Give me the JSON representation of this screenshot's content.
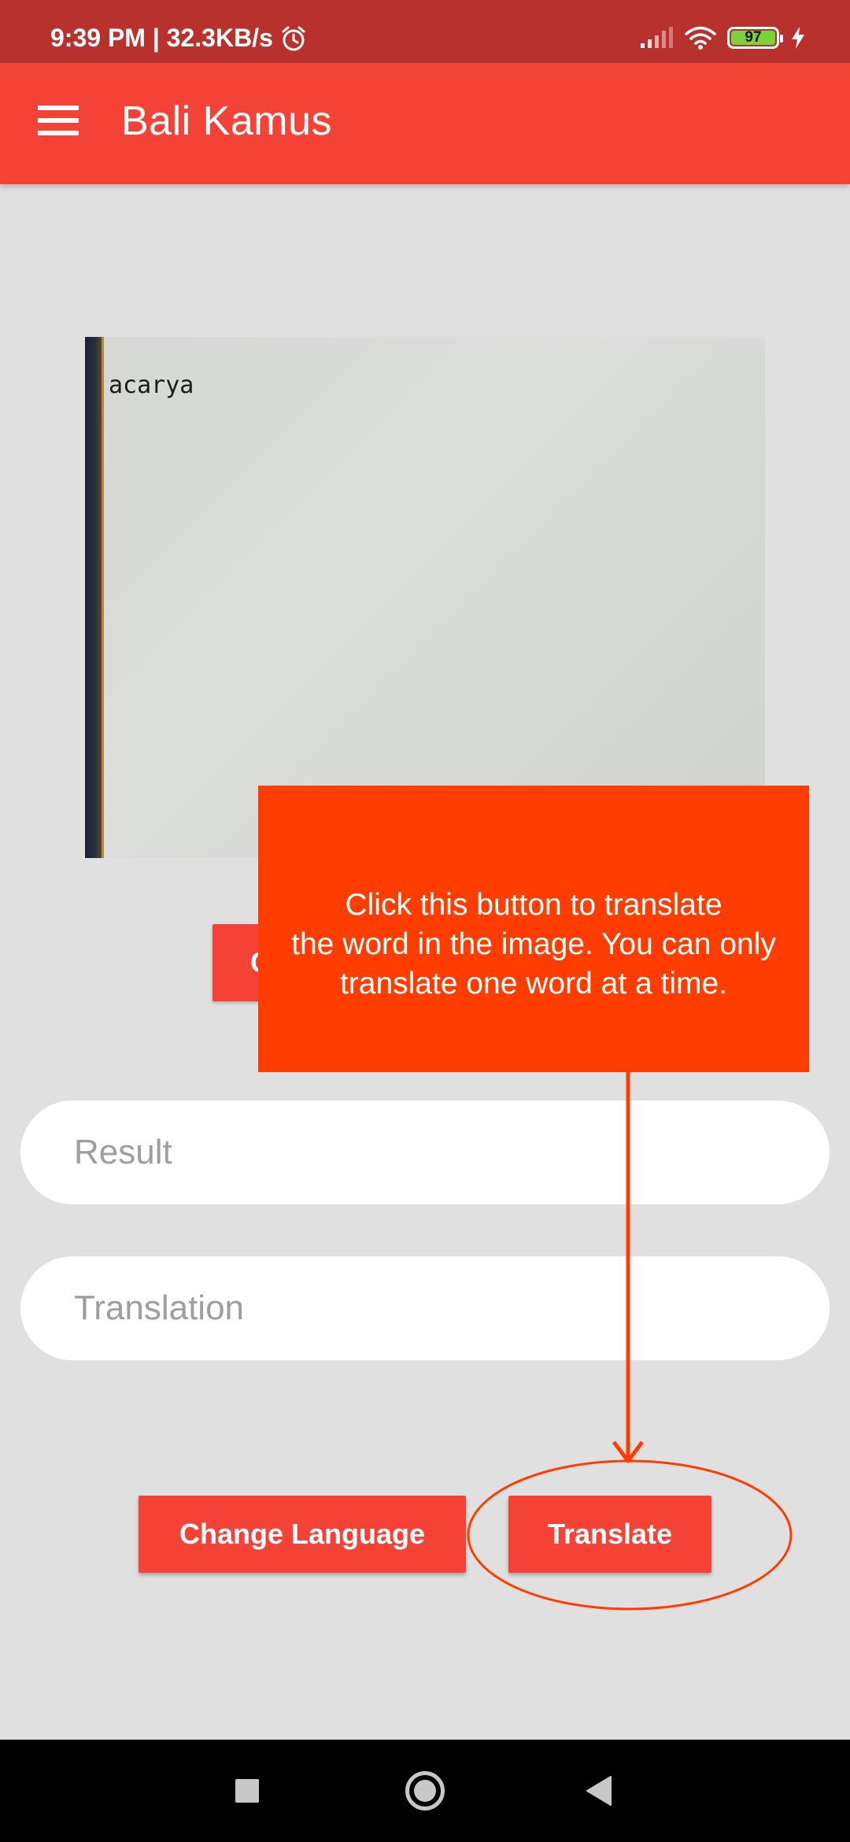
{
  "status_bar": {
    "time_and_speed": "9:39 PM | 32.3KB/s",
    "battery": "97"
  },
  "app_bar": {
    "title": "Bali Kamus"
  },
  "captured_image": {
    "word": "acarya"
  },
  "capture_button": {
    "label": "C"
  },
  "fields": {
    "result_placeholder": "Result",
    "translation_placeholder": "Translation"
  },
  "buttons": {
    "change_language": "Change Language",
    "translate": "Translate"
  },
  "tutorial": {
    "text": "Click this button to translate\nthe word in the image. You can only\ntranslate one word at a time."
  },
  "colors": {
    "primary": "#f44336",
    "status_bar": "#b8312c",
    "tooltip": "#ff3d00",
    "background": "#e0e0e0"
  },
  "icons": {
    "menu": "hamburger-menu-icon",
    "alarm": "alarm-clock-icon",
    "signal": "cell-signal-icon",
    "wifi": "wifi-icon",
    "charging": "lightning-bolt-icon",
    "nav_recents": "square-icon",
    "nav_home": "circle-icon",
    "nav_back": "triangle-back-icon"
  }
}
